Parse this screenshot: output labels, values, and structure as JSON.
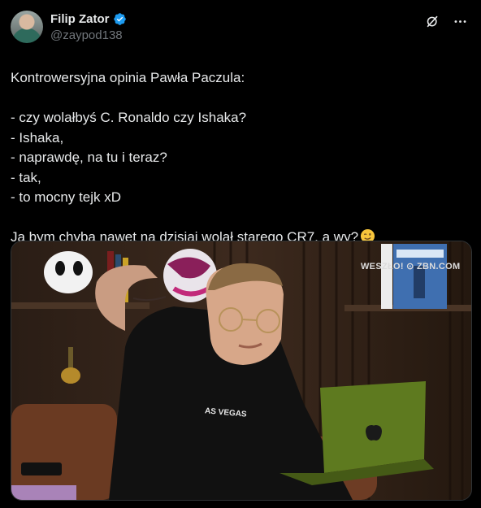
{
  "author": {
    "name": "Filip Zator",
    "handle": "@zaypod138"
  },
  "icons": {
    "verified": "verified-badge-icon",
    "grok": "grok-icon",
    "more": "more-icon",
    "wink": "winking-face-emoji"
  },
  "tweet": {
    "lines": [
      "Kontrowersyjna opinia Pawła Paczula:",
      "",
      "- czy wolałbyś C. Ronaldo czy Ishaka?",
      "- Ishaka,",
      "- naprawdę, na tu i teraz?",
      "- tak,",
      "- to mocny tejk xD",
      "",
      "Ja bym chyba nawet na dzisiaj wolał starego CR7, a wy?"
    ]
  },
  "media": {
    "watermark": "WESZŁO! ⊙ ZBN.COM",
    "shirt_text": "AS VEGAS"
  },
  "colors": {
    "background": "#000000",
    "text": "#e7e9ea",
    "muted": "#71767b",
    "verified": "#1d9bf0"
  }
}
